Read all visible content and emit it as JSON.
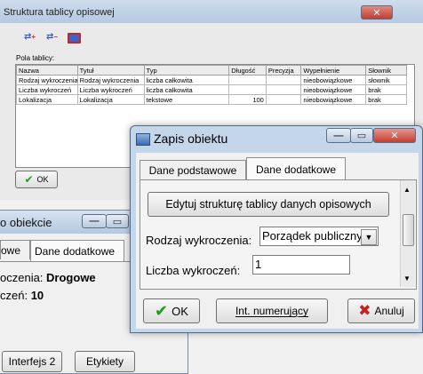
{
  "structure_window": {
    "title": "Struktura tablicy opisowej",
    "fields_label": "Pola tablicy:",
    "columns": [
      "Nazwa",
      "Tytuł",
      "Typ",
      "Długość",
      "Precyzja",
      "Wypełnienie",
      "Słownik"
    ],
    "rows": [
      [
        "Rodzaj wykroczenia",
        "Rodzaj wykroczenia",
        "liczba całkowita",
        "",
        "",
        "nieobowiązkowe",
        "słownik"
      ],
      [
        "Liczba wykroczeń",
        "Liczba wykroczeń",
        "liczba całkowita",
        "",
        "",
        "nieobowiązkowe",
        "brak"
      ],
      [
        "Lokalizacja",
        "Lokalizacja",
        "tekstowe",
        "100",
        "",
        "nieobowiązkowe",
        "brak"
      ]
    ],
    "ok_label": "OK"
  },
  "info_window": {
    "title": "o obiekcie",
    "tabs": [
      "owe",
      "Dane dodatkowe"
    ],
    "line1_label": "oczenia:",
    "line1_value": "Drogowe",
    "line2_label": "czeń:",
    "line2_value": "10",
    "btn_interfejs": "Interfejs 2",
    "btn_etykiety": "Etykiety"
  },
  "zapis_window": {
    "title": "Zapis obiektu",
    "tabs": [
      "Dane podstawowe",
      "Dane dodatkowe"
    ],
    "edit_button": "Edytuj strukturę tablicy danych opisowych",
    "rodzaj_label": "Rodzaj wykroczenia:",
    "rodzaj_value": "Porządek publiczny - :",
    "liczba_label": "Liczba wykroczeń:",
    "liczba_value": "1",
    "ok_label": "OK",
    "numer_label": "Int. numerujący",
    "anuluj_label": "Anuluj"
  },
  "colors": {
    "ok_check": "#1f9a1f",
    "cancel_x": "#c81e1e",
    "close_red": "#c9463c",
    "titlebar_blue": "#b9d1ea"
  }
}
